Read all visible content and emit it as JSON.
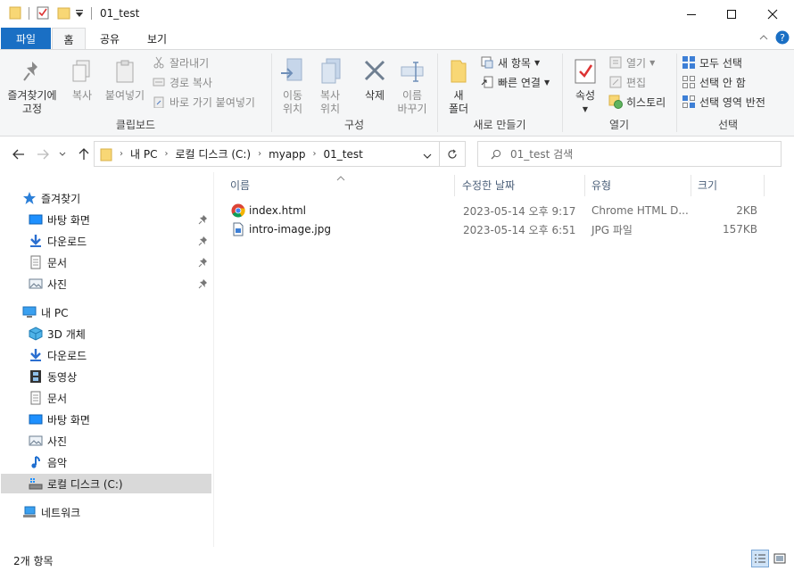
{
  "window": {
    "title": "01_test",
    "minimize_glyph": "─",
    "maximize_glyph": "☐",
    "close_glyph": "✕"
  },
  "tabs": {
    "file": "파일",
    "home": "홈",
    "share": "공유",
    "view": "보기"
  },
  "ribbon": {
    "clipboard": {
      "label": "클립보드",
      "pin_quick": "즐겨찾기에\n고정",
      "copy": "복사",
      "paste": "붙여넣기",
      "cut": "잘라내기",
      "copy_path": "경로 복사",
      "paste_shortcut": "바로 가기 붙여넣기"
    },
    "organize": {
      "label": "구성",
      "move_to": "이동\n위치",
      "copy_to": "복사\n위치",
      "delete": "삭제",
      "rename": "이름\n바꾸기"
    },
    "new": {
      "label": "새로 만들기",
      "new_folder": "새\n폴더",
      "new_item": "새 항목",
      "easy_access": "빠른 연결"
    },
    "open": {
      "label": "열기",
      "properties": "속성",
      "open": "열기",
      "edit": "편집",
      "history": "히스토리"
    },
    "select": {
      "label": "선택",
      "select_all": "모두 선택",
      "select_none": "선택 안 함",
      "invert": "선택 영역 반전"
    }
  },
  "address": {
    "crumbs": [
      "내 PC",
      "로컬 디스크 (C:)",
      "myapp",
      "01_test"
    ],
    "search_placeholder": "01_test 검색"
  },
  "nav": {
    "quick_access": "즐겨찾기",
    "qa_desktop": "바탕 화면",
    "qa_downloads": "다운로드",
    "qa_documents": "문서",
    "qa_pictures": "사진",
    "this_pc": "내 PC",
    "objects3d": "3D 개체",
    "downloads": "다운로드",
    "videos": "동영상",
    "documents": "문서",
    "desktop": "바탕 화면",
    "pictures": "사진",
    "music": "음악",
    "local_disk": "로컬 디스크 (C:)",
    "network": "네트워크"
  },
  "columns": {
    "name": "이름",
    "modified": "수정한 날짜",
    "type": "유형",
    "size": "크기"
  },
  "files": [
    {
      "name": "index.html",
      "modified": "2023-05-14 오후 9:17",
      "type": "Chrome HTML D...",
      "size": "2KB",
      "icon": "chrome-icon"
    },
    {
      "name": "intro-image.jpg",
      "modified": "2023-05-14 오후 6:51",
      "type": "JPG 파일",
      "size": "157KB",
      "icon": "image-file-icon"
    }
  ],
  "status": {
    "count": "2개 항목"
  },
  "colors": {
    "accent": "#1a6fc4",
    "folder": "#f8d775",
    "selection": "#d9d9d9"
  }
}
